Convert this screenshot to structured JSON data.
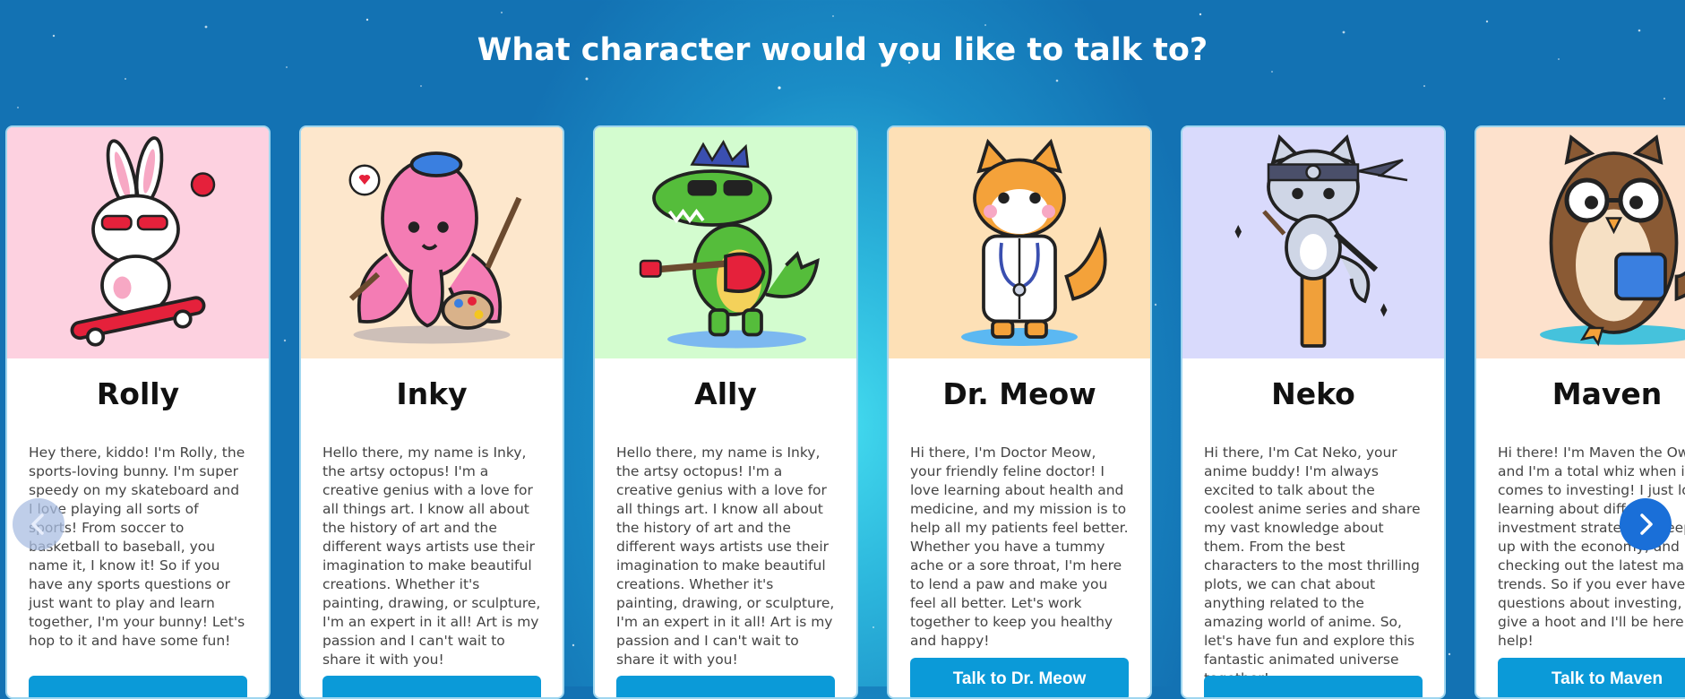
{
  "page": {
    "heading": "What character would you like to talk to?"
  },
  "carousel": {
    "prev_icon": "chevron-left-icon",
    "next_icon": "chevron-right-icon",
    "cards": [
      {
        "name": "Rolly",
        "icon": "bunny-skateboard-icon",
        "bg": "#fdd1e0",
        "description": "Hey there, kiddo! I'm Rolly, the sports-loving bunny. I'm super speedy on my skateboard and I love playing all sorts of sports! From soccer to basketball to baseball, you name it, I know it! So if you have any sports questions or just want to play and learn together, I'm your bunny! Let's hop to it and have some fun!",
        "button": ""
      },
      {
        "name": "Inky",
        "icon": "octopus-artist-icon",
        "bg": "#fde7cc",
        "description": "Hello there, my name is Inky, the artsy octopus! I'm a creative genius with a love for all things art. I know all about the history of art and the different ways artists use their imagination to make beautiful creations. Whether it's painting, drawing, or sculpture, I'm an expert in it all! Art is my passion and I can't wait to share it with you!",
        "button": ""
      },
      {
        "name": "Ally",
        "icon": "crocodile-guitar-icon",
        "bg": "#d3fccf",
        "description": "Hello there, my name is Inky, the artsy octopus! I'm a creative genius with a love for all things art. I know all about the history of art and the different ways artists use their imagination to make beautiful creations. Whether it's painting, drawing, or sculpture, I'm an expert in it all! Art is my passion and I can't wait to share it with you!",
        "button": ""
      },
      {
        "name": "Dr. Meow",
        "icon": "cat-doctor-icon",
        "bg": "#fde0b6",
        "description": "Hi there, I'm Doctor Meow, your friendly feline doctor! I love learning about health and medicine, and my mission is to help all my patients feel better. Whether you have a tummy ache or a sore throat, I'm here to lend a paw and make you feel all better. Let's work together to keep you healthy and happy!",
        "button": "Talk to Dr. Meow"
      },
      {
        "name": "Neko",
        "icon": "ninja-cat-icon",
        "bg": "#d9dafc",
        "description": "Hi there, I'm Cat Neko, your anime buddy! I'm always excited to talk about the coolest anime series and share my vast knowledge about them. From the best characters to the most thrilling plots, we can chat about anything related to the amazing world of anime. So, let's have fun and explore this fantastic animated universe together!",
        "button": ""
      },
      {
        "name": "Maven",
        "icon": "owl-investor-icon",
        "bg": "#fde1cc",
        "description": "Hi there! I'm Maven the Owl, and I'm a total whiz when it comes to investing! I just love learning about different investment strategies, keeping up with the economy, and checking out the latest market trends. So if you ever have any questions about investing, just give a hoot and I'll be here to help!",
        "button": "Talk to Maven"
      }
    ]
  }
}
